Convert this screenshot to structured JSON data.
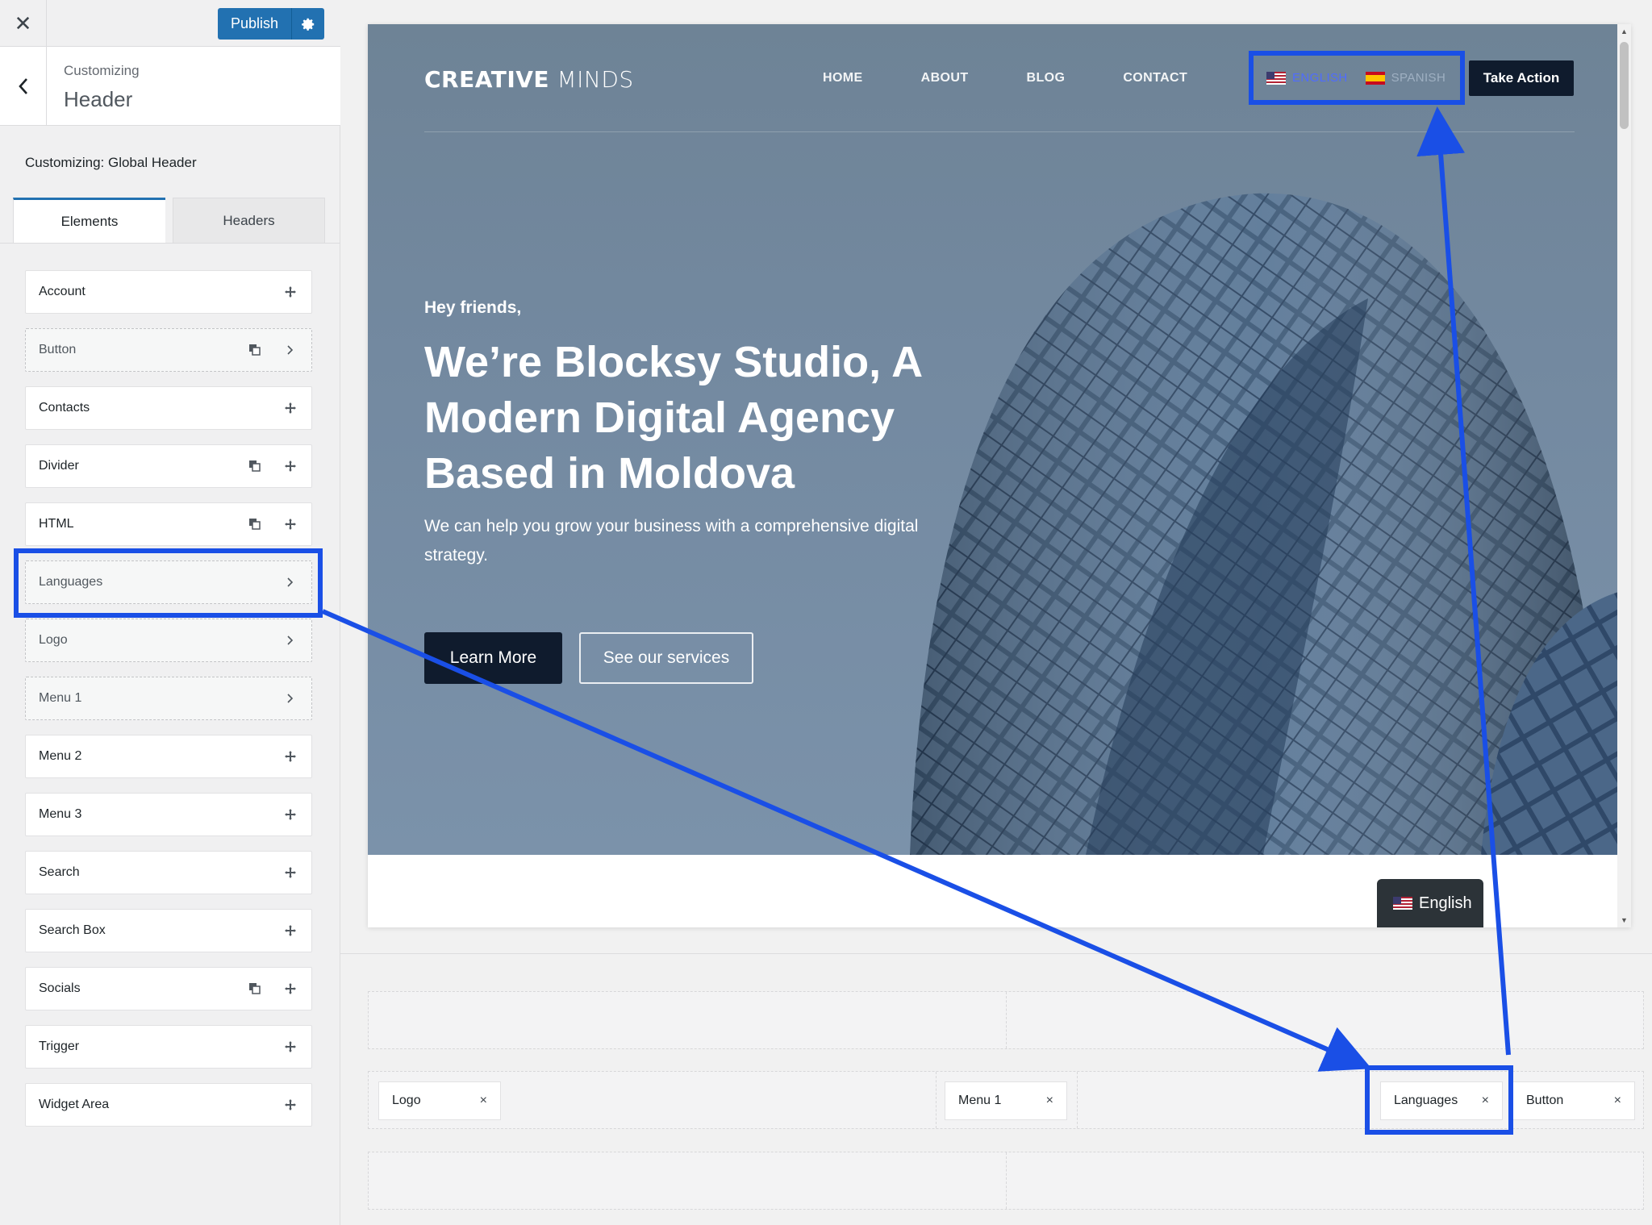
{
  "topbar": {
    "close_icon": "close-icon",
    "publish_label": "Publish",
    "gear_icon": "gear-icon"
  },
  "section": {
    "crumb": "Customizing",
    "title": "Header"
  },
  "panel": {
    "global_title": "Customizing: Global Header"
  },
  "tabs": [
    {
      "label": "Elements"
    },
    {
      "label": "Headers"
    }
  ],
  "elements": [
    {
      "label": "Account"
    },
    {
      "label": "Button"
    },
    {
      "label": "Contacts"
    },
    {
      "label": "Divider"
    },
    {
      "label": "HTML"
    },
    {
      "label": "Languages"
    },
    {
      "label": "Logo"
    },
    {
      "label": "Menu 1"
    },
    {
      "label": "Menu 2"
    },
    {
      "label": "Menu 3"
    },
    {
      "label": "Search"
    },
    {
      "label": "Search Box"
    },
    {
      "label": "Socials"
    },
    {
      "label": "Trigger"
    },
    {
      "label": "Widget Area"
    }
  ],
  "site": {
    "logo_bold": "CREATIVE",
    "logo_light": "MINDS",
    "nav": [
      "HOME",
      "ABOUT",
      "BLOG",
      "CONTACT"
    ],
    "lang_english": "ENGLISH",
    "lang_spanish": "SPANISH",
    "cta": "Take Action",
    "eyebrow": "Hey friends,",
    "headline": "We’re Blocksy Studio, A Modern Digital Agency Based in Moldova",
    "subtext": "We can help you grow your business with a comprehensive digital strategy.",
    "btn_primary": "Learn More",
    "btn_secondary": "See our services",
    "floating_lang": "English"
  },
  "builder": {
    "middle_row": [
      {
        "label": "Logo"
      },
      {
        "label": "Menu 1"
      },
      {
        "label": "Languages"
      },
      {
        "label": "Button"
      }
    ],
    "remove_glyph": "×"
  },
  "colors": {
    "accent": "#2271b1",
    "highlight": "#1a4fe6",
    "dark": "#0f1b2d"
  }
}
